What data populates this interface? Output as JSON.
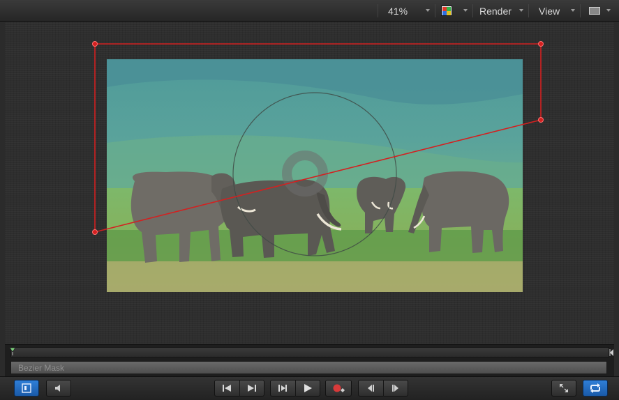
{
  "toolbar": {
    "zoom_value": "41%",
    "render_label": "Render",
    "view_label": "View",
    "color_channel_icon": "color-channels-icon",
    "layout_icon": "canvas-layout-icon"
  },
  "canvas": {
    "image_subject": "elephants-photo",
    "shape_color": "#d42020",
    "onscreen_control_color": "#6e6e6e"
  },
  "timeline": {
    "track_label": "Bezier Mask"
  },
  "transport": {
    "buttons": [
      {
        "name": "timing-view-button",
        "icon": "timing-view-icon",
        "active": true
      },
      {
        "name": "audio-button",
        "icon": "speaker-icon",
        "active": false
      },
      {
        "name": "go-to-start-button",
        "icon": "skip-to-start-icon",
        "active": false
      },
      {
        "name": "go-to-end-button",
        "icon": "skip-to-end-icon",
        "active": false
      },
      {
        "name": "step-frame-button",
        "icon": "step-forward-icon",
        "active": false
      },
      {
        "name": "play-button",
        "icon": "play-icon",
        "active": false
      },
      {
        "name": "record-button",
        "icon": "record-icon",
        "active": false
      },
      {
        "name": "previous-frame-button",
        "icon": "previous-frame-icon",
        "active": false
      },
      {
        "name": "next-frame-button",
        "icon": "next-frame-icon",
        "active": false
      },
      {
        "name": "full-screen-button",
        "icon": "expand-icon",
        "active": false
      },
      {
        "name": "loop-playback-button",
        "icon": "loop-icon",
        "active": true
      }
    ],
    "accent_color": "#2f7fd8",
    "record_color": "#d83a3a"
  }
}
